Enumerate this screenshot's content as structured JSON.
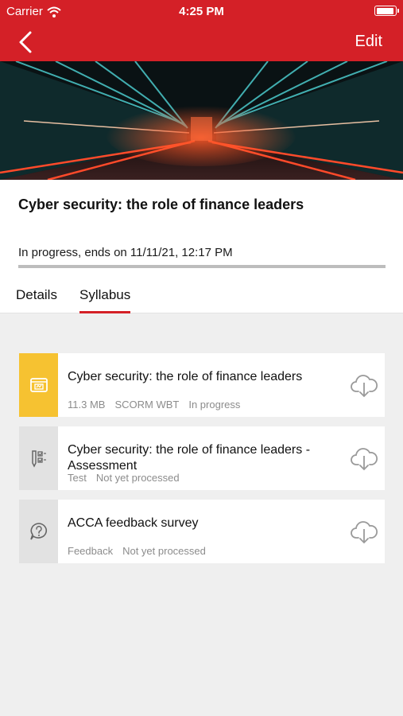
{
  "status_bar": {
    "carrier": "Carrier",
    "time": "4:25 PM"
  },
  "nav": {
    "edit_label": "Edit"
  },
  "course": {
    "title": "Cyber security: the role of finance leaders",
    "status": "In progress, ends on 11/11/21, 12:17 PM"
  },
  "tabs": [
    {
      "label": "Details",
      "active": false
    },
    {
      "label": "Syllabus",
      "active": true
    }
  ],
  "syllabus": [
    {
      "icon": "scorm-package-icon",
      "title": "Cyber security: the role of finance leaders",
      "meta": [
        "11.3 MB",
        "SCORM WBT",
        "In progress"
      ]
    },
    {
      "icon": "test-checklist-icon",
      "title": "Cyber security: the role of finance leaders - Assessment",
      "meta": [
        "Test",
        "Not yet processed"
      ]
    },
    {
      "icon": "feedback-question-icon",
      "title": "ACCA feedback survey",
      "meta": [
        "Feedback",
        "Not yet processed"
      ]
    }
  ],
  "colors": {
    "brand": "#d42027",
    "scorm": "#f6c231",
    "meta_text": "#8c8c8c"
  }
}
